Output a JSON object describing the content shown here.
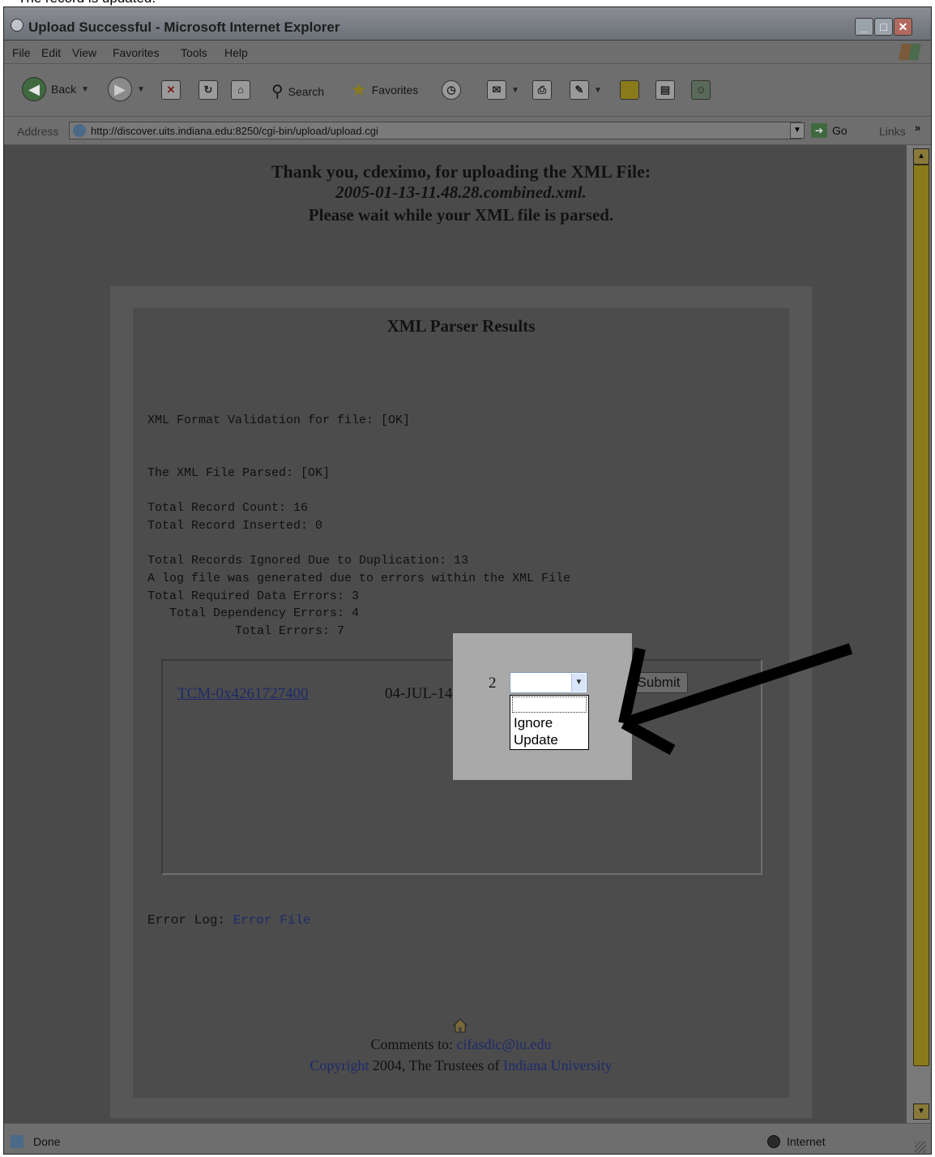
{
  "caption": "The record is updated.",
  "window": {
    "title": "Upload Successful - Microsoft Internet Explorer"
  },
  "menu": [
    "File",
    "Edit",
    "View",
    "Favorites",
    "Tools",
    "Help"
  ],
  "toolbar": {
    "back": "Back",
    "search": "Search",
    "favorites": "Favorites"
  },
  "address": {
    "label": "Address",
    "url": "http://discover.uits.indiana.edu:8250/cgi-bin/upload/upload.cgi",
    "go": "Go",
    "links": "Links"
  },
  "page": {
    "thank_you": "Thank you, cdeximo, for uploading the XML File:",
    "filename": "2005-01-13-11.48.28.combined.xml.",
    "wait": "Please wait while your XML file is parsed.",
    "results_title": "XML Parser Results",
    "validation": "XML Format Validation for file: [OK]",
    "parsed": "The XML File Parsed: [OK]",
    "record_count": "Total Record Count: 16",
    "record_inserted": "Total Record Inserted: 0",
    "ignored": "Total Records Ignored Due to Duplication: 13",
    "log_generated": "A log file was generated due to errors within the XML File",
    "required_errors": "Total Required Data Errors: 3",
    "dependency_errors": "   Total Dependency Errors: 4",
    "total_errors": "            Total Errors: 7",
    "record": {
      "id": "TCM-0x4261727400",
      "date": "04-JUL-14",
      "count": "2",
      "options": [
        "",
        "Ignore",
        "Update"
      ],
      "submit": "Submit"
    },
    "error_log_label": "Error Log: ",
    "error_log_link": "Error File",
    "comments_label": "Comments to: ",
    "comments_email": "cifasdic@iu.edu",
    "copyright_link": "Copyright",
    "copyright_text": " 2004, The Trustees of ",
    "university_link": "Indiana University"
  },
  "status": {
    "text": "Done",
    "zone": "Internet"
  }
}
